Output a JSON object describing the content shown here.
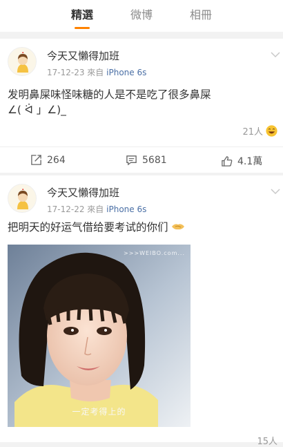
{
  "tabs": [
    {
      "label": "精選",
      "active": true
    },
    {
      "label": "微博",
      "active": false
    },
    {
      "label": "相冊",
      "active": false
    }
  ],
  "colors": {
    "accent": "#ff8200",
    "link": "#4a6fa5",
    "muted": "#999999"
  },
  "posts": [
    {
      "username": "今天又懶得加班",
      "date": "17-12-23",
      "source_prefix": "來自",
      "source": "iPhone 6s",
      "text_line1": "发明鼻屎味怪味糖的人是不是吃了很多鼻屎",
      "text_line2": "∠( ᐛ 」∠)_",
      "likes": "21人",
      "reposts": "264",
      "comments": "5681",
      "like_count": "4.1萬"
    },
    {
      "username": "今天又懶得加班",
      "date": "17-12-22",
      "source_prefix": "來自",
      "source": "iPhone 6s",
      "text": "把明天的好运气借给要考试的你们",
      "image": {
        "watermark": ">>>WEIBO.com...",
        "caption": "一定考得上的"
      },
      "likes": "15人"
    }
  ]
}
